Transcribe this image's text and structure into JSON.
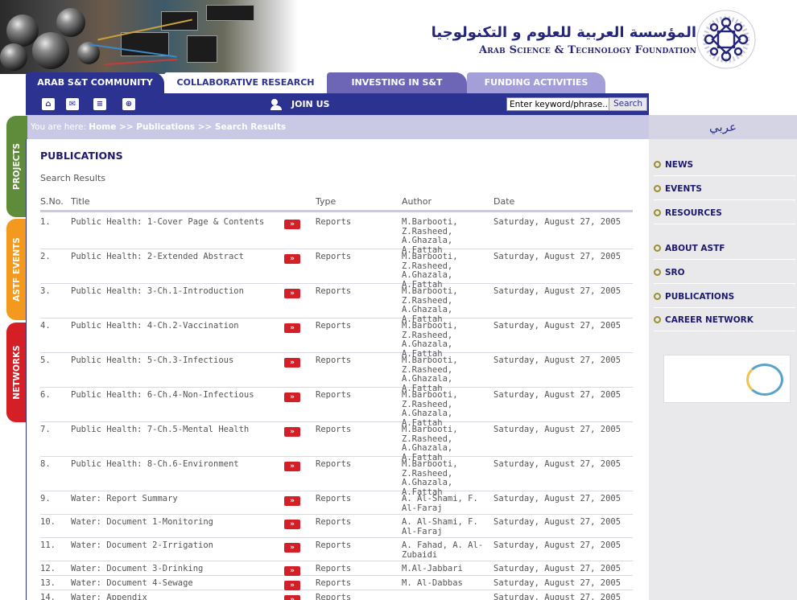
{
  "header": {
    "foundation_arabic": "المؤسسة العربية للعلوم و التكنولوجيا",
    "foundation_english": "Arab Science & Technology Foundation"
  },
  "tabs": [
    {
      "label": "ARAB S&T COMMUNITY"
    },
    {
      "label": "COLLABORATIVE RESEARCH"
    },
    {
      "label": "INVESTING IN S&T"
    },
    {
      "label": "FUNDING ACTIVITIES"
    }
  ],
  "toolbar": {
    "icons": [
      "home-icon",
      "mail-icon",
      "document-icon",
      "sitemap-icon"
    ],
    "join_label": "JOIN US",
    "search_value": "Enter keyword/phrase...",
    "search_button": "Search"
  },
  "breadcrumb": {
    "prefix": "You are here: ",
    "home": "Home",
    "sep1": " >> ",
    "publications": "Publications",
    "sep2": " >> ",
    "current": "Search Results"
  },
  "side_tabs": [
    "PROJECTS",
    "ASTF EVENTS",
    "NETWORKS"
  ],
  "right_panel": {
    "arabic_link": "عربي",
    "nav": [
      "NEWS",
      "EVENTS",
      "RESOURCES",
      "ABOUT ASTF",
      "SRO",
      "PUBLICATIONS",
      "CAREER NETWORK"
    ]
  },
  "content": {
    "title": "PUBLICATIONS",
    "subtitle": "Search Results",
    "columns": {
      "num": "S.No.",
      "title": "Title",
      "type": "Type",
      "author": "Author",
      "date": "Date"
    },
    "rows": [
      {
        "num": "1.",
        "title": "Public Health: 1-Cover Page & Contents",
        "type": "Reports",
        "author": "M.Barbooti, Z.Rasheed, A.Ghazala, A.Fattah",
        "date": "Saturday, August 27, 2005"
      },
      {
        "num": "2.",
        "title": "Public Health: 2-Extended Abstract",
        "type": "Reports",
        "author": "M.Barbooti, Z.Rasheed, A.Ghazala, A.Fattah",
        "date": "Saturday, August 27, 2005"
      },
      {
        "num": "3.",
        "title": "Public Health: 3-Ch.1-Introduction",
        "type": "Reports",
        "author": "M.Barbooti, Z.Rasheed, A.Ghazala, A.Fattah",
        "date": "Saturday, August 27, 2005"
      },
      {
        "num": "4.",
        "title": "Public Health: 4-Ch.2-Vaccination",
        "type": "Reports",
        "author": "M.Barbooti, Z.Rasheed, A.Ghazala, A.Fattah",
        "date": "Saturday, August 27, 2005"
      },
      {
        "num": "5.",
        "title": "Public Health: 5-Ch.3-Infectious",
        "type": "Reports",
        "author": "M.Barbooti, Z.Rasheed, A.Ghazala, A.Fattah",
        "date": "Saturday, August 27, 2005"
      },
      {
        "num": "6.",
        "title": "Public Health: 6-Ch.4-Non-Infectious",
        "type": "Reports",
        "author": "M.Barbooti, Z.Rasheed, A.Ghazala, A.Fattah",
        "date": "Saturday, August 27, 2005"
      },
      {
        "num": "7.",
        "title": "Public Health: 7-Ch.5-Mental Health",
        "type": "Reports",
        "author": "M.Barbooti, Z.Rasheed, A.Ghazala, A.Fattah",
        "date": "Saturday, August 27, 2005"
      },
      {
        "num": "8.",
        "title": "Public Health: 8-Ch.6-Environment",
        "type": "Reports",
        "author": "M.Barbooti, Z.Rasheed, A.Ghazala, A.Fattah",
        "date": "Saturday, August 27, 2005"
      },
      {
        "num": "9.",
        "title": "Water: Report Summary",
        "type": "Reports",
        "author": "A. Al-Shami, F. Al-Faraj",
        "date": "Saturday, August 27, 2005"
      },
      {
        "num": "10.",
        "title": "Water: Document 1-Monitoring",
        "type": "Reports",
        "author": "A. Al-Shami, F. Al-Faraj",
        "date": "Saturday, August 27, 2005"
      },
      {
        "num": "11.",
        "title": "Water: Document 2-Irrigation",
        "type": "Reports",
        "author": "A. Fahad, A. Al-Zubaidi",
        "date": "Saturday, August 27, 2005"
      },
      {
        "num": "12.",
        "title": "Water: Document 3-Drinking",
        "type": "Reports",
        "author": "M.Al-Jabbari",
        "date": "Saturday, August 27, 2005"
      },
      {
        "num": "13.",
        "title": "Water: Document 4-Sewage",
        "type": "Reports",
        "author": "M. Al-Dabbas",
        "date": "Saturday, August 27, 2005"
      },
      {
        "num": "14.",
        "title": "Water: Appendix",
        "type": "Reports",
        "author": "",
        "date": "Saturday, August 27, 2005"
      }
    ]
  },
  "colors": {
    "navy": "#2b3290",
    "lavender": "#c9c9e6",
    "red": "#d41f26",
    "green": "#5e8c3a",
    "orange": "#f39a1e"
  }
}
